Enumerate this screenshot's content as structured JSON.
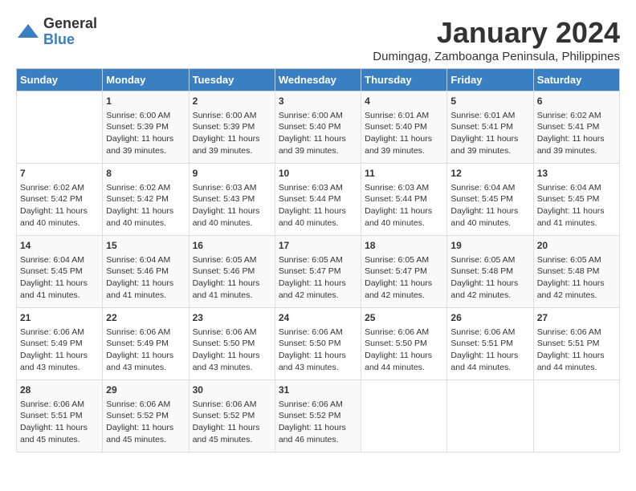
{
  "logo": {
    "general": "General",
    "blue": "Blue"
  },
  "title": "January 2024",
  "location": "Dumingag, Zamboanga Peninsula, Philippines",
  "days_of_week": [
    "Sunday",
    "Monday",
    "Tuesday",
    "Wednesday",
    "Thursday",
    "Friday",
    "Saturday"
  ],
  "weeks": [
    [
      {
        "day": "",
        "sunrise": "",
        "sunset": "",
        "daylight": ""
      },
      {
        "day": "1",
        "sunrise": "Sunrise: 6:00 AM",
        "sunset": "Sunset: 5:39 PM",
        "daylight": "Daylight: 11 hours and 39 minutes."
      },
      {
        "day": "2",
        "sunrise": "Sunrise: 6:00 AM",
        "sunset": "Sunset: 5:39 PM",
        "daylight": "Daylight: 11 hours and 39 minutes."
      },
      {
        "day": "3",
        "sunrise": "Sunrise: 6:00 AM",
        "sunset": "Sunset: 5:40 PM",
        "daylight": "Daylight: 11 hours and 39 minutes."
      },
      {
        "day": "4",
        "sunrise": "Sunrise: 6:01 AM",
        "sunset": "Sunset: 5:40 PM",
        "daylight": "Daylight: 11 hours and 39 minutes."
      },
      {
        "day": "5",
        "sunrise": "Sunrise: 6:01 AM",
        "sunset": "Sunset: 5:41 PM",
        "daylight": "Daylight: 11 hours and 39 minutes."
      },
      {
        "day": "6",
        "sunrise": "Sunrise: 6:02 AM",
        "sunset": "Sunset: 5:41 PM",
        "daylight": "Daylight: 11 hours and 39 minutes."
      }
    ],
    [
      {
        "day": "7",
        "sunrise": "Sunrise: 6:02 AM",
        "sunset": "Sunset: 5:42 PM",
        "daylight": "Daylight: 11 hours and 40 minutes."
      },
      {
        "day": "8",
        "sunrise": "Sunrise: 6:02 AM",
        "sunset": "Sunset: 5:42 PM",
        "daylight": "Daylight: 11 hours and 40 minutes."
      },
      {
        "day": "9",
        "sunrise": "Sunrise: 6:03 AM",
        "sunset": "Sunset: 5:43 PM",
        "daylight": "Daylight: 11 hours and 40 minutes."
      },
      {
        "day": "10",
        "sunrise": "Sunrise: 6:03 AM",
        "sunset": "Sunset: 5:44 PM",
        "daylight": "Daylight: 11 hours and 40 minutes."
      },
      {
        "day": "11",
        "sunrise": "Sunrise: 6:03 AM",
        "sunset": "Sunset: 5:44 PM",
        "daylight": "Daylight: 11 hours and 40 minutes."
      },
      {
        "day": "12",
        "sunrise": "Sunrise: 6:04 AM",
        "sunset": "Sunset: 5:45 PM",
        "daylight": "Daylight: 11 hours and 40 minutes."
      },
      {
        "day": "13",
        "sunrise": "Sunrise: 6:04 AM",
        "sunset": "Sunset: 5:45 PM",
        "daylight": "Daylight: 11 hours and 41 minutes."
      }
    ],
    [
      {
        "day": "14",
        "sunrise": "Sunrise: 6:04 AM",
        "sunset": "Sunset: 5:45 PM",
        "daylight": "Daylight: 11 hours and 41 minutes."
      },
      {
        "day": "15",
        "sunrise": "Sunrise: 6:04 AM",
        "sunset": "Sunset: 5:46 PM",
        "daylight": "Daylight: 11 hours and 41 minutes."
      },
      {
        "day": "16",
        "sunrise": "Sunrise: 6:05 AM",
        "sunset": "Sunset: 5:46 PM",
        "daylight": "Daylight: 11 hours and 41 minutes."
      },
      {
        "day": "17",
        "sunrise": "Sunrise: 6:05 AM",
        "sunset": "Sunset: 5:47 PM",
        "daylight": "Daylight: 11 hours and 42 minutes."
      },
      {
        "day": "18",
        "sunrise": "Sunrise: 6:05 AM",
        "sunset": "Sunset: 5:47 PM",
        "daylight": "Daylight: 11 hours and 42 minutes."
      },
      {
        "day": "19",
        "sunrise": "Sunrise: 6:05 AM",
        "sunset": "Sunset: 5:48 PM",
        "daylight": "Daylight: 11 hours and 42 minutes."
      },
      {
        "day": "20",
        "sunrise": "Sunrise: 6:05 AM",
        "sunset": "Sunset: 5:48 PM",
        "daylight": "Daylight: 11 hours and 42 minutes."
      }
    ],
    [
      {
        "day": "21",
        "sunrise": "Sunrise: 6:06 AM",
        "sunset": "Sunset: 5:49 PM",
        "daylight": "Daylight: 11 hours and 43 minutes."
      },
      {
        "day": "22",
        "sunrise": "Sunrise: 6:06 AM",
        "sunset": "Sunset: 5:49 PM",
        "daylight": "Daylight: 11 hours and 43 minutes."
      },
      {
        "day": "23",
        "sunrise": "Sunrise: 6:06 AM",
        "sunset": "Sunset: 5:50 PM",
        "daylight": "Daylight: 11 hours and 43 minutes."
      },
      {
        "day": "24",
        "sunrise": "Sunrise: 6:06 AM",
        "sunset": "Sunset: 5:50 PM",
        "daylight": "Daylight: 11 hours and 43 minutes."
      },
      {
        "day": "25",
        "sunrise": "Sunrise: 6:06 AM",
        "sunset": "Sunset: 5:50 PM",
        "daylight": "Daylight: 11 hours and 44 minutes."
      },
      {
        "day": "26",
        "sunrise": "Sunrise: 6:06 AM",
        "sunset": "Sunset: 5:51 PM",
        "daylight": "Daylight: 11 hours and 44 minutes."
      },
      {
        "day": "27",
        "sunrise": "Sunrise: 6:06 AM",
        "sunset": "Sunset: 5:51 PM",
        "daylight": "Daylight: 11 hours and 44 minutes."
      }
    ],
    [
      {
        "day": "28",
        "sunrise": "Sunrise: 6:06 AM",
        "sunset": "Sunset: 5:51 PM",
        "daylight": "Daylight: 11 hours and 45 minutes."
      },
      {
        "day": "29",
        "sunrise": "Sunrise: 6:06 AM",
        "sunset": "Sunset: 5:52 PM",
        "daylight": "Daylight: 11 hours and 45 minutes."
      },
      {
        "day": "30",
        "sunrise": "Sunrise: 6:06 AM",
        "sunset": "Sunset: 5:52 PM",
        "daylight": "Daylight: 11 hours and 45 minutes."
      },
      {
        "day": "31",
        "sunrise": "Sunrise: 6:06 AM",
        "sunset": "Sunset: 5:52 PM",
        "daylight": "Daylight: 11 hours and 46 minutes."
      },
      {
        "day": "",
        "sunrise": "",
        "sunset": "",
        "daylight": ""
      },
      {
        "day": "",
        "sunrise": "",
        "sunset": "",
        "daylight": ""
      },
      {
        "day": "",
        "sunrise": "",
        "sunset": "",
        "daylight": ""
      }
    ]
  ]
}
